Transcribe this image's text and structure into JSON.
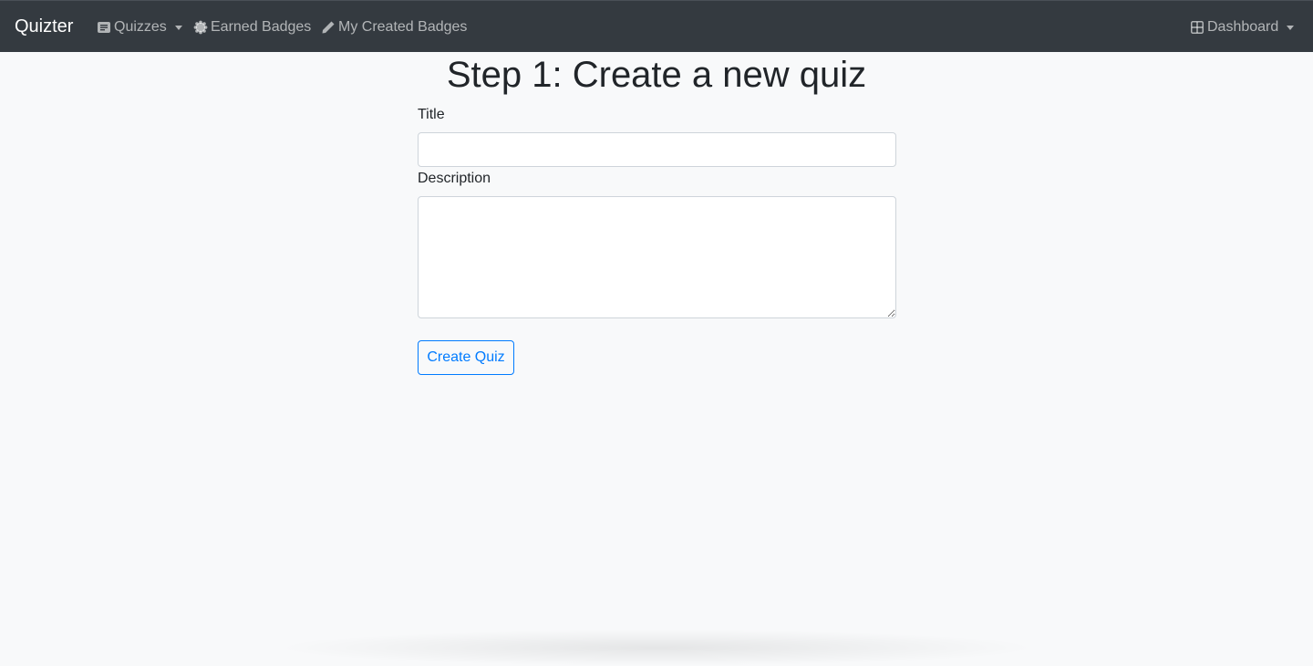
{
  "navbar": {
    "brand": "Quizter",
    "items": [
      {
        "label": "Quizzes",
        "icon": "quiz-list-icon",
        "dropdown": true
      },
      {
        "label": "Earned Badges",
        "icon": "badge-icon",
        "dropdown": false
      },
      {
        "label": "My Created Badges",
        "icon": "pencil-icon",
        "dropdown": false
      }
    ],
    "dashboard": {
      "label": "Dashboard",
      "icon": "grid-icon",
      "dropdown": true
    }
  },
  "main": {
    "title": "Step 1: Create a new quiz",
    "form": {
      "title_label": "Title",
      "title_value": "",
      "description_label": "Description",
      "description_value": "",
      "submit_label": "Create Quiz"
    }
  },
  "colors": {
    "navbar_bg": "#343a40",
    "page_bg": "#f8f9fa",
    "accent": "#007bff"
  }
}
